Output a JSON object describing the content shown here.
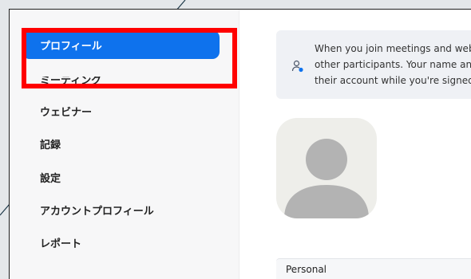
{
  "sidebar": {
    "items": [
      {
        "label": "プロフィール"
      },
      {
        "label": "ミーティング"
      },
      {
        "label": "ウェビナー"
      },
      {
        "label": "記録"
      },
      {
        "label": "設定"
      },
      {
        "label": "アカウントプロフィール"
      },
      {
        "label": "レポート"
      }
    ],
    "active_index": 0
  },
  "banner": {
    "icon": "user-dot-icon",
    "lines": [
      "When you join meetings and web",
      "other participants. Your name and",
      "their account while you're signed"
    ]
  },
  "profile": {
    "avatar": "default-avatar-icon",
    "section_label": "Personal"
  },
  "colors": {
    "accent": "#0e72ed",
    "highlight": "#ff0000"
  }
}
